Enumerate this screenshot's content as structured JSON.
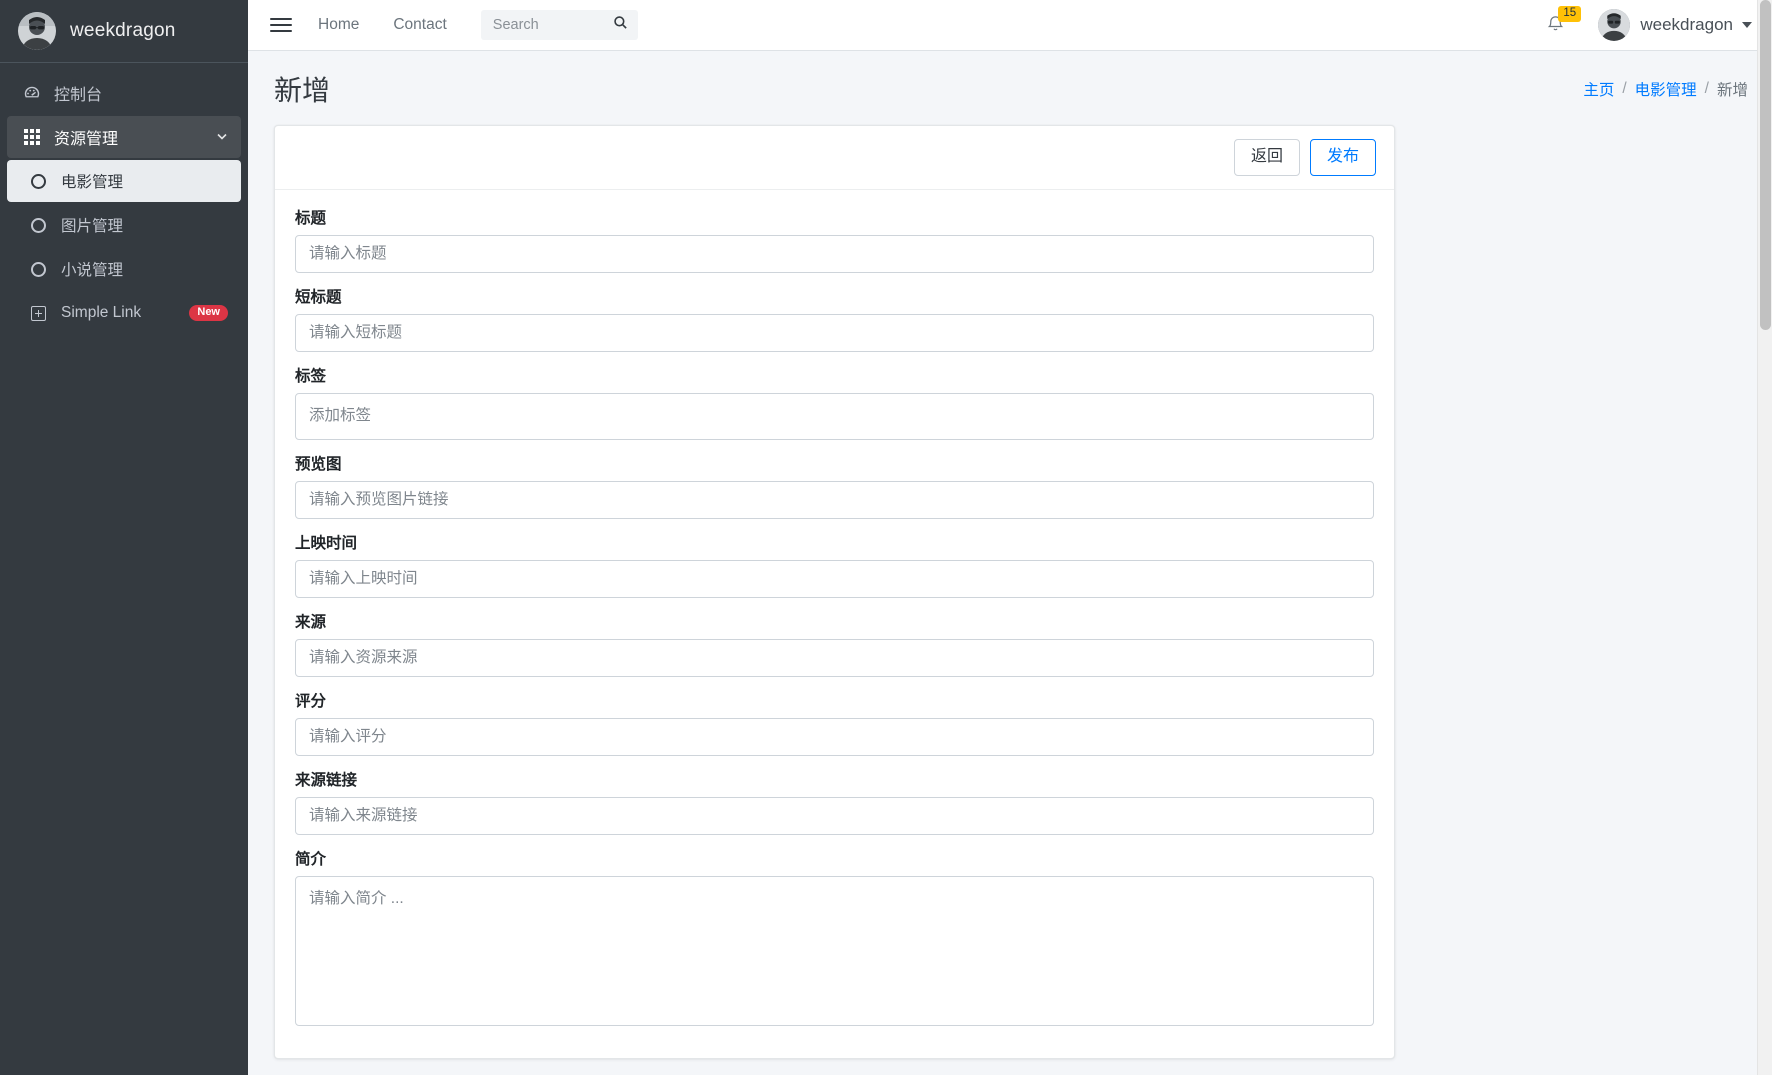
{
  "sidebar": {
    "brand_name": "weekdragon",
    "brand_avatar_icon": "user-avatar-image",
    "items": [
      {
        "label": "控制台",
        "icon": "dashboard-icon",
        "type": "link",
        "active": false
      },
      {
        "label": "资源管理",
        "icon": "grid-icon",
        "type": "group",
        "active": false,
        "expanded": true,
        "chevron": "chevron-down-icon"
      }
    ],
    "sub_items": [
      {
        "label": "电影管理",
        "icon": "circle-icon",
        "active": true
      },
      {
        "label": "图片管理",
        "icon": "circle-icon",
        "active": false
      },
      {
        "label": "小说管理",
        "icon": "circle-icon",
        "active": false
      },
      {
        "label": "Simple Link",
        "icon": "plus-square-icon",
        "active": false,
        "badge": "New"
      }
    ]
  },
  "topbar": {
    "menu_toggle_icon": "hamburger-icon",
    "links": [
      {
        "label": "Home"
      },
      {
        "label": "Contact"
      }
    ],
    "search": {
      "placeholder": "Search",
      "value": "",
      "icon": "search-icon"
    },
    "notifications": {
      "icon": "bell-icon",
      "count": "15"
    },
    "user": {
      "name": "weekdragon",
      "avatar_icon": "user-avatar-image",
      "caret_icon": "caret-down-icon"
    }
  },
  "content": {
    "page_title": "新增",
    "breadcrumb": {
      "items": [
        {
          "label": "主页",
          "link": true
        },
        {
          "label": "电影管理",
          "link": true
        },
        {
          "label": "新增",
          "link": false
        }
      ],
      "separator": "/"
    },
    "card": {
      "actions": {
        "back_label": "返回",
        "publish_label": "发布"
      },
      "fields": [
        {
          "label": "标题",
          "placeholder": "请输入标题",
          "value": "",
          "type": "text"
        },
        {
          "label": "短标题",
          "placeholder": "请输入短标题",
          "value": "",
          "type": "text"
        },
        {
          "label": "标签",
          "placeholder": "添加标签",
          "value": "",
          "type": "tags"
        },
        {
          "label": "预览图",
          "placeholder": "请输入预览图片链接",
          "value": "",
          "type": "text"
        },
        {
          "label": "上映时间",
          "placeholder": "请输入上映时间",
          "value": "",
          "type": "text"
        },
        {
          "label": "来源",
          "placeholder": "请输入资源来源",
          "value": "",
          "type": "text"
        },
        {
          "label": "评分",
          "placeholder": "请输入评分",
          "value": "",
          "type": "text"
        },
        {
          "label": "来源链接",
          "placeholder": "请输入来源链接",
          "value": "",
          "type": "text"
        },
        {
          "label": "简介",
          "placeholder": "请输入简介 ...",
          "value": "",
          "type": "textarea"
        }
      ]
    }
  },
  "colors": {
    "sidebar_bg": "#343a40",
    "sidebar_active_bg": "#e9ecef",
    "accent": "#007bff",
    "badge_new": "#dc3545",
    "badge_notification": "#ffc107",
    "page_bg": "#f4f6f9"
  }
}
